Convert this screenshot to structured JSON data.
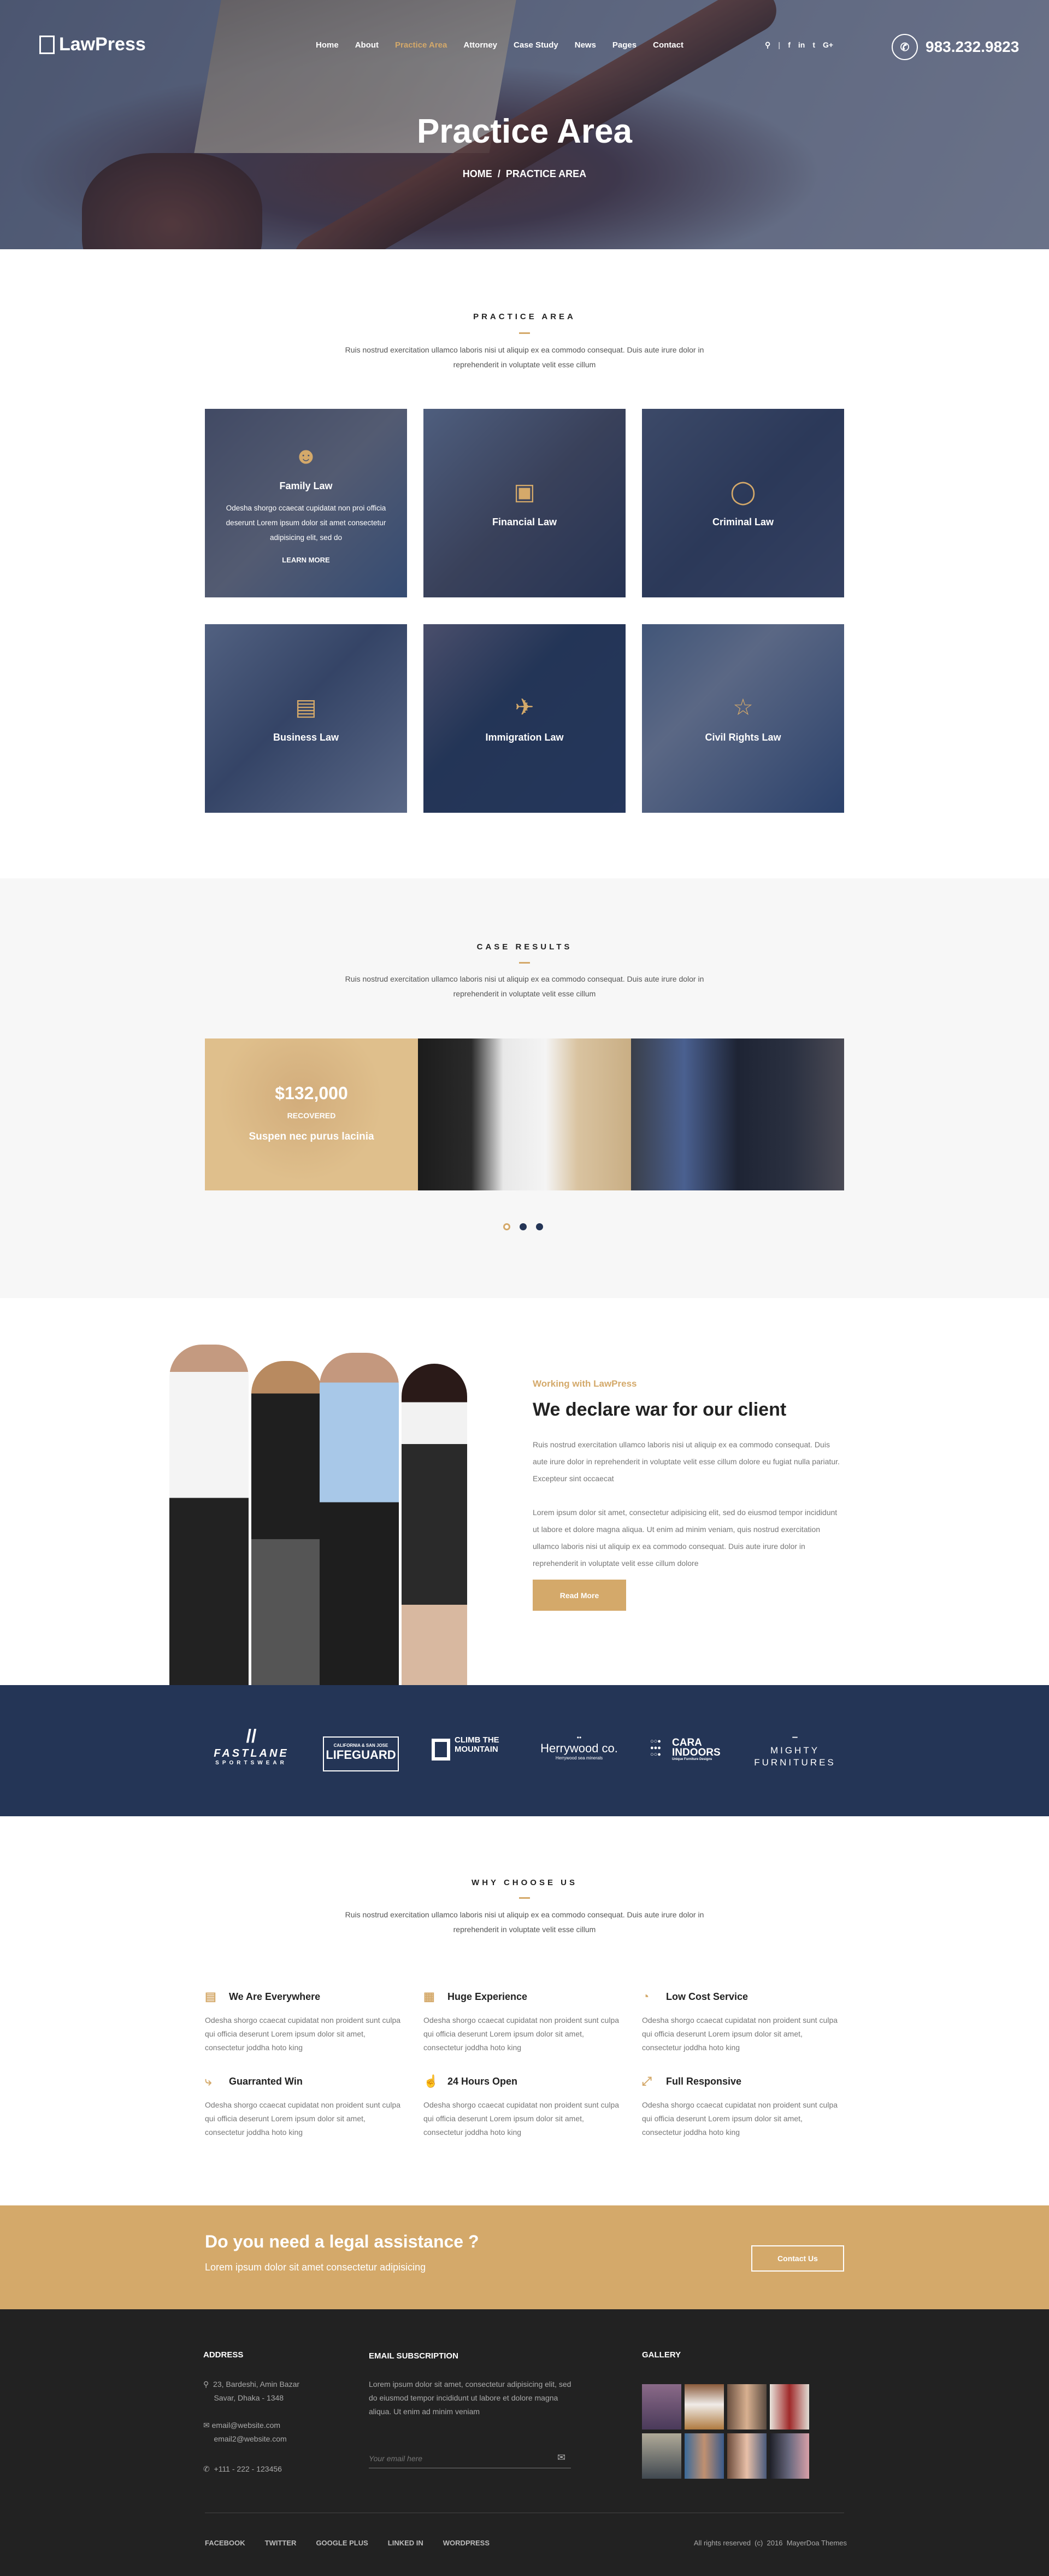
{
  "header": {
    "logo": "LawPress",
    "nav": [
      "Home",
      "About",
      "Practice Area",
      "Attorney",
      "Case Study",
      "News",
      "Pages",
      "Contact"
    ],
    "active_nav": "Practice Area",
    "social": [
      "f",
      "in",
      "t",
      "G+"
    ],
    "phone": "983.232.9823",
    "title": "Practice Area",
    "breadcrumb": {
      "home": "HOME",
      "sep": "/",
      "current": "PRACTICE AREA"
    }
  },
  "practice": {
    "title": "PRACTICE AREA",
    "text": "Ruis nostrud exercitation ullamco laboris nisi ut aliquip ex ea commodo consequat. Duis aute irure dolor in reprehenderit in voluptate velit esse cillum",
    "cards": [
      {
        "title": "Family Law",
        "icon": "users-icon",
        "desc": "Odesha shorgo ccaecat cupidatat non proi officia deserunt Lorem ipsum dolor sit amet consectetur adipisicing elit, sed do",
        "link": "LEARN MORE"
      },
      {
        "title": "Financial Law",
        "icon": "wallet-icon"
      },
      {
        "title": "Criminal Law",
        "icon": "ghost-icon"
      },
      {
        "title": "Business Law",
        "icon": "briefcase-icon"
      },
      {
        "title": "Immigration Law",
        "icon": "airplane-icon"
      },
      {
        "title": "Civil Rights Law",
        "icon": "magic-wand-icon"
      }
    ]
  },
  "cases": {
    "title": "CASE RESULTS",
    "text": "Ruis nostrud exercitation ullamco laboris nisi ut aliquip ex ea commodo consequat. Duis aute irure dolor in reprehenderit in voluptate velit esse cillum",
    "amount": "$132,000",
    "recovered": "RECOVERED",
    "caption": "Suspen nec purus lacinia",
    "active_dot": 1,
    "dots": 3
  },
  "about": {
    "kicker": "Working with LawPress",
    "heading": "We declare war for our client",
    "p1": "Ruis nostrud exercitation ullamco laboris nisi ut aliquip ex ea commodo consequat. Duis aute irure dolor in reprehenderit in voluptate velit esse cillum dolore eu fugiat nulla pariatur. Excepteur sint occaecat",
    "p2": "Lorem ipsum dolor sit amet, consectetur adipisicing elit, sed do eiusmod tempor incididunt ut labore et dolore magna aliqua. Ut enim ad minim veniam, quis nostrud exercitation ullamco laboris nisi ut aliquip ex ea commodo consequat. Duis aute irure dolor in reprehenderit in voluptate velit esse cillum dolore",
    "button": "Read More"
  },
  "clients": [
    {
      "name": "FASTLANE",
      "sub": "SPORTSWEAR"
    },
    {
      "name": "LIFEGUARD",
      "sub": "CALIFORNIA & SAN JOSE"
    },
    {
      "name": "CLIMB THE MOUNTAIN"
    },
    {
      "name": "Herrywood co.",
      "sub": "Herrywood sea minerals"
    },
    {
      "name": "CARA INDOORS",
      "sub": "Unique Furniture Designs"
    },
    {
      "name": "MIGHTY FURNITURES"
    }
  ],
  "why": {
    "title": "WHY CHOOSE US",
    "text": "Ruis nostrud exercitation ullamco laboris nisi ut aliquip ex ea commodo consequat. Duis aute irure dolor in reprehenderit in voluptate velit esse cillum",
    "features": [
      {
        "title": "We Are Everywhere",
        "icon": "image-icon",
        "desc": "Odesha shorgo ccaecat cupidatat non proident sunt culpa qui officia deserunt Lorem ipsum dolor sit amet, consectetur joddha hoto king"
      },
      {
        "title": "Huge Experience",
        "icon": "gift-icon",
        "desc": "Odesha shorgo ccaecat cupidatat non proident sunt culpa qui officia deserunt Lorem ipsum dolor sit amet, consectetur joddha hoto king"
      },
      {
        "title": "Low Cost Service",
        "icon": "pie-chart-icon",
        "desc": "Odesha shorgo ccaecat cupidatat non proident sunt culpa qui officia deserunt Lorem ipsum dolor sit amet, consectetur joddha hoto king"
      },
      {
        "title": "Guarranted Win",
        "icon": "flow-icon",
        "desc": "Odesha shorgo ccaecat cupidatat non proident sunt culpa qui officia deserunt Lorem ipsum dolor sit amet, consectetur joddha hoto king"
      },
      {
        "title": "24 Hours Open",
        "icon": "thumbs-up-icon",
        "desc": "Odesha shorgo ccaecat cupidatat non proident sunt culpa qui officia deserunt Lorem ipsum dolor sit amet, consectetur joddha hoto king"
      },
      {
        "title": "Full Responsive",
        "icon": "expand-icon",
        "desc": "Odesha shorgo ccaecat cupidatat non proident sunt culpa qui officia deserunt Lorem ipsum dolor sit amet, consectetur joddha hoto king"
      }
    ]
  },
  "cta": {
    "title": "Do you need a legal assistance ?",
    "sub": "Lorem ipsum dolor sit amet consectetur adipisicing",
    "button": "Contact Us"
  },
  "footer": {
    "address_title": "ADDRESS",
    "address1": "23, Bardeshi, Amin Bazar",
    "address2": "Savar, Dhaka - 1348",
    "email1": "email@website.com",
    "email2": "email2@website.com",
    "phone": "+111 - 222 - 123456",
    "sub_title": "EMAIL SUBSCRIPTION",
    "sub_text": "Lorem ipsum dolor sit amet, consectetur adipisicing elit, sed do eiusmod tempor incididunt ut labore et dolore magna aliqua. Ut enim ad minim veniam",
    "email_placeholder": "Your email here",
    "gallery_title": "GALLERY",
    "links": [
      "FACEBOOK",
      "TWITTER",
      "GOOGLE PLUS",
      "LINKED IN",
      "WORDPRESS"
    ],
    "copyright": "All rights reserved  (c)  2016  MayerDoa Themes"
  },
  "colors": {
    "accent": "#d4a96a",
    "navy": "#243556",
    "footer": "#222222"
  }
}
